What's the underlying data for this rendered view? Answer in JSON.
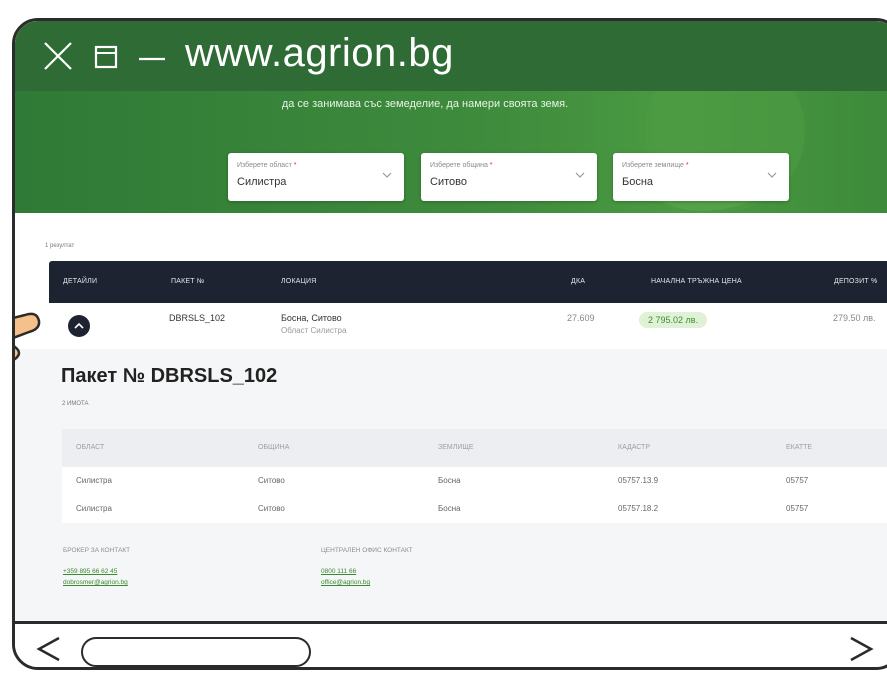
{
  "browser": {
    "url": "www.agrion.bg"
  },
  "hero": {
    "tagline": "да се занимава със земеделие, да намери своята земя.",
    "selects": [
      {
        "label": "Изберете област",
        "value": "Силистра"
      },
      {
        "label": "Изберете община",
        "value": "Ситово"
      },
      {
        "label": "Изберете землище",
        "value": "Босна"
      }
    ]
  },
  "results": {
    "count_text": "1 резултат"
  },
  "table": {
    "headers": [
      "ДЕТАЙЛИ",
      "ПАКЕТ №",
      "ЛОКАЦИЯ",
      "ДКА",
      "НАЧАЛНА ТРЪЖНА ЦЕНА",
      "ДЕПОЗИТ %"
    ],
    "row": {
      "package": "DBRSLS_102",
      "location": "Босна, Ситово",
      "region": "Област Силистра",
      "area": "27.609",
      "price": "2 795.02 лв.",
      "deposit": "279.50 лв."
    }
  },
  "detail": {
    "title": "Пакет № DBRSLS_102",
    "count": "2 ИМОТА",
    "headers": [
      "ОБЛАСТ",
      "ОБЩИНА",
      "ЗЕМЛИЩЕ",
      "КАДАСТР",
      "ЕКАТТЕ"
    ],
    "rows": [
      [
        "Силистра",
        "Ситово",
        "Босна",
        "05757.13.9",
        "05757"
      ],
      [
        "Силистра",
        "Ситово",
        "Босна",
        "05757.18.2",
        "05757"
      ]
    ],
    "broker_heading": "БРОКЕР ЗА КОНТАКТ",
    "broker_phone": "+359 895 66 62 45",
    "broker_email": "dobrosmer@agrion.bg",
    "office_heading": "ЦЕНТРАЛЕН ОФИС КОНТАКТ",
    "office_phone": "0800 111 66",
    "office_email": "office@agrion.bg"
  },
  "colors": {
    "brand_green": "#2e6b35",
    "table_header": "#1e2332",
    "price_badge": "#dff2d5"
  },
  "icons": [
    "close-icon",
    "maximize-icon",
    "minimize-icon",
    "chevron-down-icon",
    "chevron-up-icon",
    "pointing-hand-icon",
    "back-icon",
    "forward-icon"
  ]
}
